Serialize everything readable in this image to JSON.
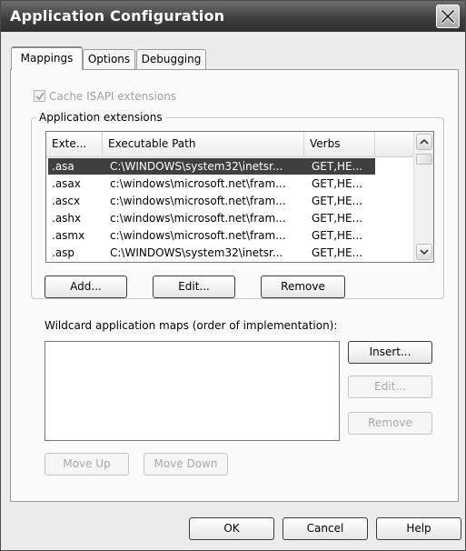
{
  "window": {
    "title": "Application Configuration"
  },
  "tabs": [
    {
      "label": "Mappings",
      "active": true
    },
    {
      "label": "Options",
      "active": false
    },
    {
      "label": "Debugging",
      "active": false
    }
  ],
  "mappings": {
    "cache_isapi": {
      "label": "Cache ISAPI extensions",
      "checked": true,
      "enabled": false
    },
    "app_extensions_group": "Application extensions",
    "columns": [
      "Exte...",
      "Executable Path",
      "Verbs"
    ],
    "rows": [
      {
        "ext": ".asa",
        "path": "C:\\WINDOWS\\system32\\inetsr...",
        "verbs": "GET,HE...",
        "selected": true
      },
      {
        "ext": ".asax",
        "path": "c:\\windows\\microsoft.net\\fram...",
        "verbs": "GET,HE...",
        "selected": false
      },
      {
        "ext": ".ascx",
        "path": "c:\\windows\\microsoft.net\\fram...",
        "verbs": "GET,HE...",
        "selected": false
      },
      {
        "ext": ".ashx",
        "path": "c:\\windows\\microsoft.net\\fram...",
        "verbs": "GET,HE...",
        "selected": false
      },
      {
        "ext": ".asmx",
        "path": "c:\\windows\\microsoft.net\\fram...",
        "verbs": "GET,HE...",
        "selected": false
      },
      {
        "ext": ".asp",
        "path": "C:\\WINDOWS\\system32\\inetsr...",
        "verbs": "GET,HE...",
        "selected": false
      }
    ],
    "buttons": {
      "add": "Add...",
      "edit": "Edit...",
      "remove": "Remove"
    },
    "wildcard": {
      "label": "Wildcard application maps (order of implementation):",
      "insert": "Insert...",
      "edit": "Edit...",
      "remove": "Remove",
      "move_up": "Move Up",
      "move_down": "Move Down"
    }
  },
  "footer": {
    "ok": "OK",
    "cancel": "Cancel",
    "help": "Help"
  },
  "colors": {
    "titlebar": "#3c3c3c",
    "selection": "#404040",
    "panel": "#fbfbfb"
  }
}
